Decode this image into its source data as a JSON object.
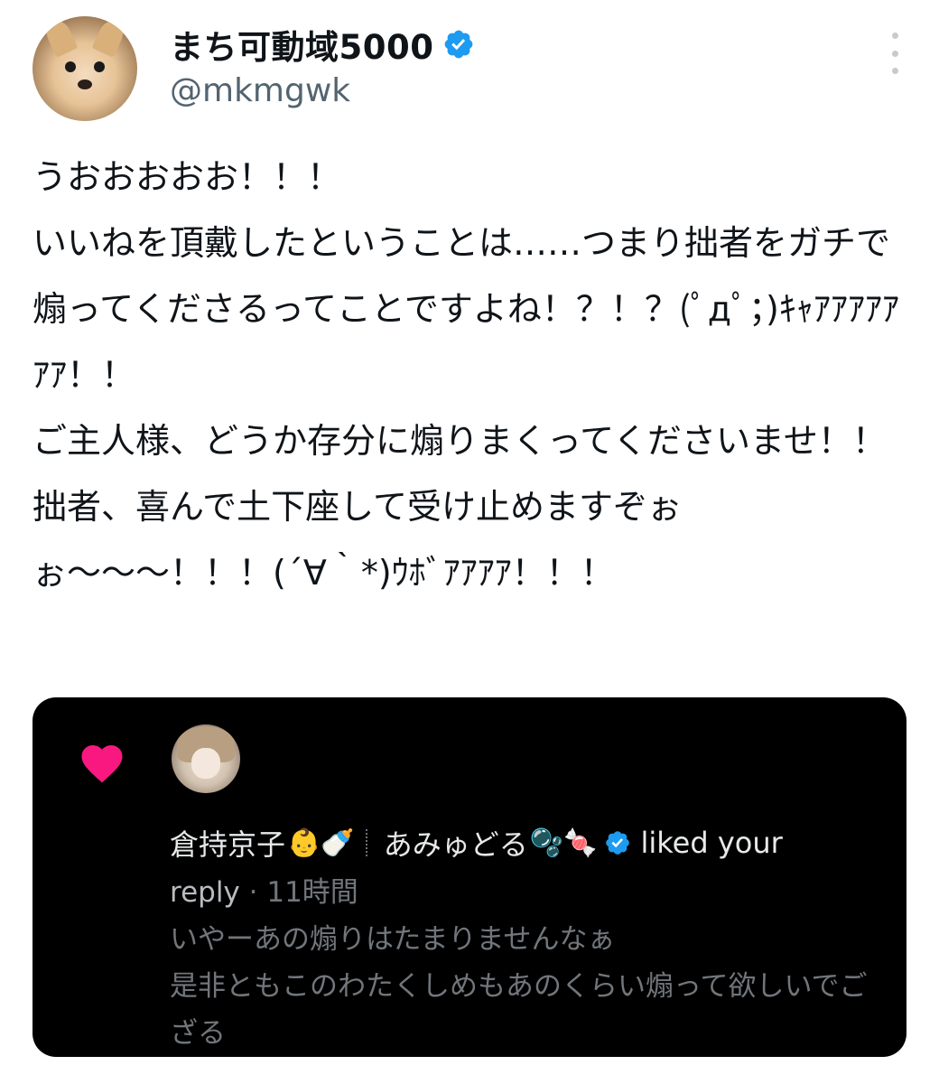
{
  "tweet": {
    "author_name": "まち可動域5000",
    "author_handle": "@mkmgwk",
    "verified": true,
    "text": "うおおおおお！！！\nいいねを頂戴したということは……つまり拙者をガチで煽ってくださるってことですよね！？！？(ﾟдﾟ；)ｷｬｱｱｱｱｱｱｱ！！\nご主人様、どうか存分に煽りまくってくださいませ！！ 拙者、喜んで土下座して受け止めますぞぉぉ〜〜〜！！！(´∀｀*)ｳﾎﾞｱｱｱｱ！！！"
  },
  "notification": {
    "icon": "heart-icon",
    "liker_name": "倉持京子",
    "liker_emojis": "👶🍼",
    "liker_name2": "あみゅどる",
    "liker_emojis2": "🫧🍬",
    "action": "liked your",
    "target": "reply",
    "time": "· 11時間",
    "reply_text": "いやーあの煽りはたまりませんなぁ\n是非ともこのわたくしめもあのくらい煽って欲しいでござる"
  },
  "colors": {
    "verified_blue": "#1d9bf0",
    "heart_pink": "#f91880",
    "card_bg": "#000000",
    "muted_text": "#71767b"
  }
}
